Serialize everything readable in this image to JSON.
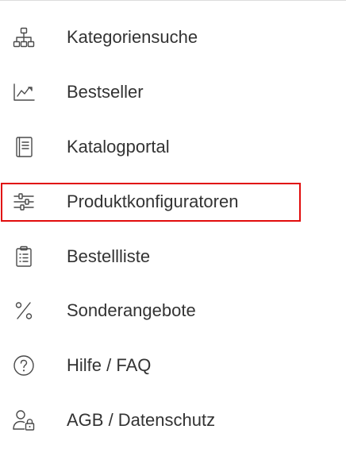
{
  "highlight_color": "#e10c0c",
  "menu": {
    "items": [
      {
        "label": "Kategoriensuche",
        "icon": "sitemap-icon"
      },
      {
        "label": "Bestseller",
        "icon": "trend-chart-icon"
      },
      {
        "label": "Katalogportal",
        "icon": "book-icon"
      },
      {
        "label": "Produktkonfiguratoren",
        "icon": "sliders-icon",
        "highlighted": true
      },
      {
        "label": "Bestellliste",
        "icon": "clipboard-list-icon"
      },
      {
        "label": "Sonderangebote",
        "icon": "percent-icon"
      },
      {
        "label": "Hilfe / FAQ",
        "icon": "help-circle-icon"
      },
      {
        "label": "AGB / Datenschutz",
        "icon": "user-lock-icon"
      }
    ]
  }
}
